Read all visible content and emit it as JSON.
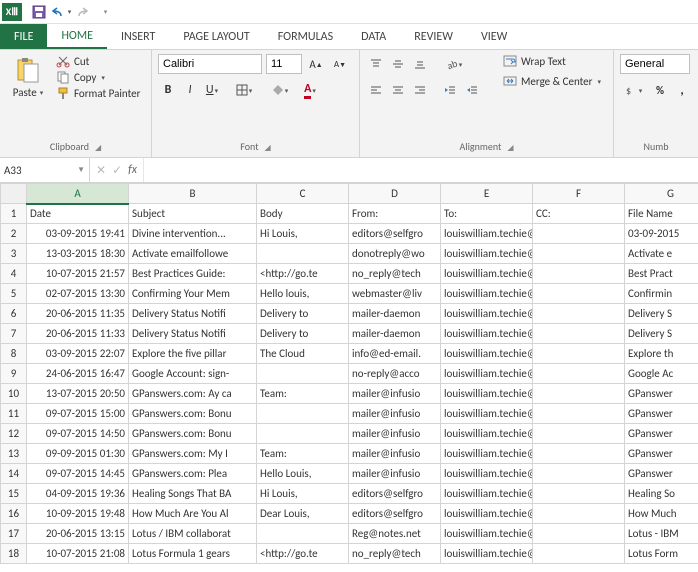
{
  "qat": {
    "app": "XⅢ"
  },
  "tabs": {
    "file": "FILE",
    "items": [
      "HOME",
      "INSERT",
      "PAGE LAYOUT",
      "FORMULAS",
      "DATA",
      "REVIEW",
      "VIEW"
    ],
    "active": 0
  },
  "ribbon": {
    "clipboard": {
      "label": "Clipboard",
      "paste": "Paste",
      "cut": "Cut",
      "copy": "Copy",
      "format_painter": "Format Painter"
    },
    "font": {
      "label": "Font",
      "name_value": "Calibri",
      "size_value": "11"
    },
    "alignment": {
      "label": "Alignment",
      "wrap": "Wrap Text",
      "merge": "Merge & Center"
    },
    "number": {
      "label": "Numb",
      "format_value": "General"
    }
  },
  "name_box": "A33",
  "fx_label": "fx",
  "columns": [
    "A",
    "B",
    "C",
    "D",
    "E",
    "F",
    "G"
  ],
  "selected_col": "A",
  "headers": [
    "Date",
    "Subject",
    "Body",
    "From:",
    "To:",
    "CC:",
    "File Name"
  ],
  "rows": [
    [
      "03-09-2015 19:41",
      "Divine intervention...",
      "Hi Louis,",
      "editors@selfgro",
      "louiswilliam.techie@gmail.c",
      "",
      "03-09-2015"
    ],
    [
      "13-03-2015 18:30",
      "Activate emailfollowe",
      "",
      "donotreply@wo",
      "louiswilliam.techie@gmail.c",
      "",
      "Activate e"
    ],
    [
      "10-07-2015 21:57",
      "Best Practices Guide:",
      "<http://go.te",
      "no_reply@tech",
      "louiswilliam.techie@gmail.c",
      "",
      "Best Pract"
    ],
    [
      "02-07-2015 13:30",
      "Confirming Your Mem",
      "Hello louis,",
      "webmaster@liv",
      "louiswilliam.techie@gmail.c",
      "",
      "Confirmin"
    ],
    [
      "20-06-2015 11:35",
      "Delivery Status Notifi",
      "Delivery to",
      "mailer-daemon",
      "louiswilliam.techie@gmail.c",
      "",
      "Delivery S"
    ],
    [
      "20-06-2015 11:33",
      "Delivery Status Notifi",
      "Delivery to",
      "mailer-daemon",
      "louiswilliam.techie@gmail.c",
      "",
      "Delivery S"
    ],
    [
      "03-09-2015 22:07",
      "Explore the five pillar",
      "The Cloud",
      "info@ed-email.",
      "louiswilliam.techie@gmail.c",
      "",
      "Explore th"
    ],
    [
      "24-06-2015 16:47",
      "Google Account: sign-",
      "",
      "no-reply@acco",
      "louiswilliam.techie@gmail.c",
      "",
      "Google Ac"
    ],
    [
      "13-07-2015 20:50",
      "GPanswers.com: Ay ca",
      "Team:",
      "mailer@infusio",
      "louiswilliam.techie@gmail.c",
      "",
      "GPanswer"
    ],
    [
      "09-07-2015 15:00",
      "GPanswers.com: Bonu",
      "",
      "mailer@infusio",
      "louiswilliam.techie@gmail.c",
      "",
      "GPanswer"
    ],
    [
      "09-07-2015 14:50",
      "GPanswers.com: Bonu",
      "",
      "mailer@infusio",
      "louiswilliam.techie@gmail.c",
      "",
      "GPanswer"
    ],
    [
      "09-09-2015 01:30",
      "GPanswers.com: My I",
      "Team:",
      "mailer@infusio",
      "louiswilliam.techie@gmail.c",
      "",
      "GPanswer"
    ],
    [
      "09-07-2015 14:45",
      "GPanswers.com: Plea",
      "Hello Louis,",
      "mailer@infusio",
      "louiswilliam.techie@gmail.c",
      "",
      "GPanswer"
    ],
    [
      "04-09-2015 19:36",
      "Healing Songs That BA",
      "Hi Louis,",
      "editors@selfgro",
      "louiswilliam.techie@gmail.c",
      "",
      "Healing So"
    ],
    [
      "10-09-2015 19:48",
      "How Much Are You Al",
      "Dear Louis,",
      "editors@selfgro",
      "louiswilliam.techie@gmail.c",
      "",
      "How Much"
    ],
    [
      "20-06-2015 13:15",
      "Lotus / IBM collaborat",
      "",
      "Reg@notes.net",
      "louiswilliam.techie@gmail.c",
      "",
      "Lotus - IBM"
    ],
    [
      "10-07-2015 21:08",
      "Lotus Formula 1 gears",
      "<http://go.te",
      "no_reply@tech",
      "louiswilliam.techie@gmail.c",
      "",
      "Lotus Form"
    ]
  ]
}
